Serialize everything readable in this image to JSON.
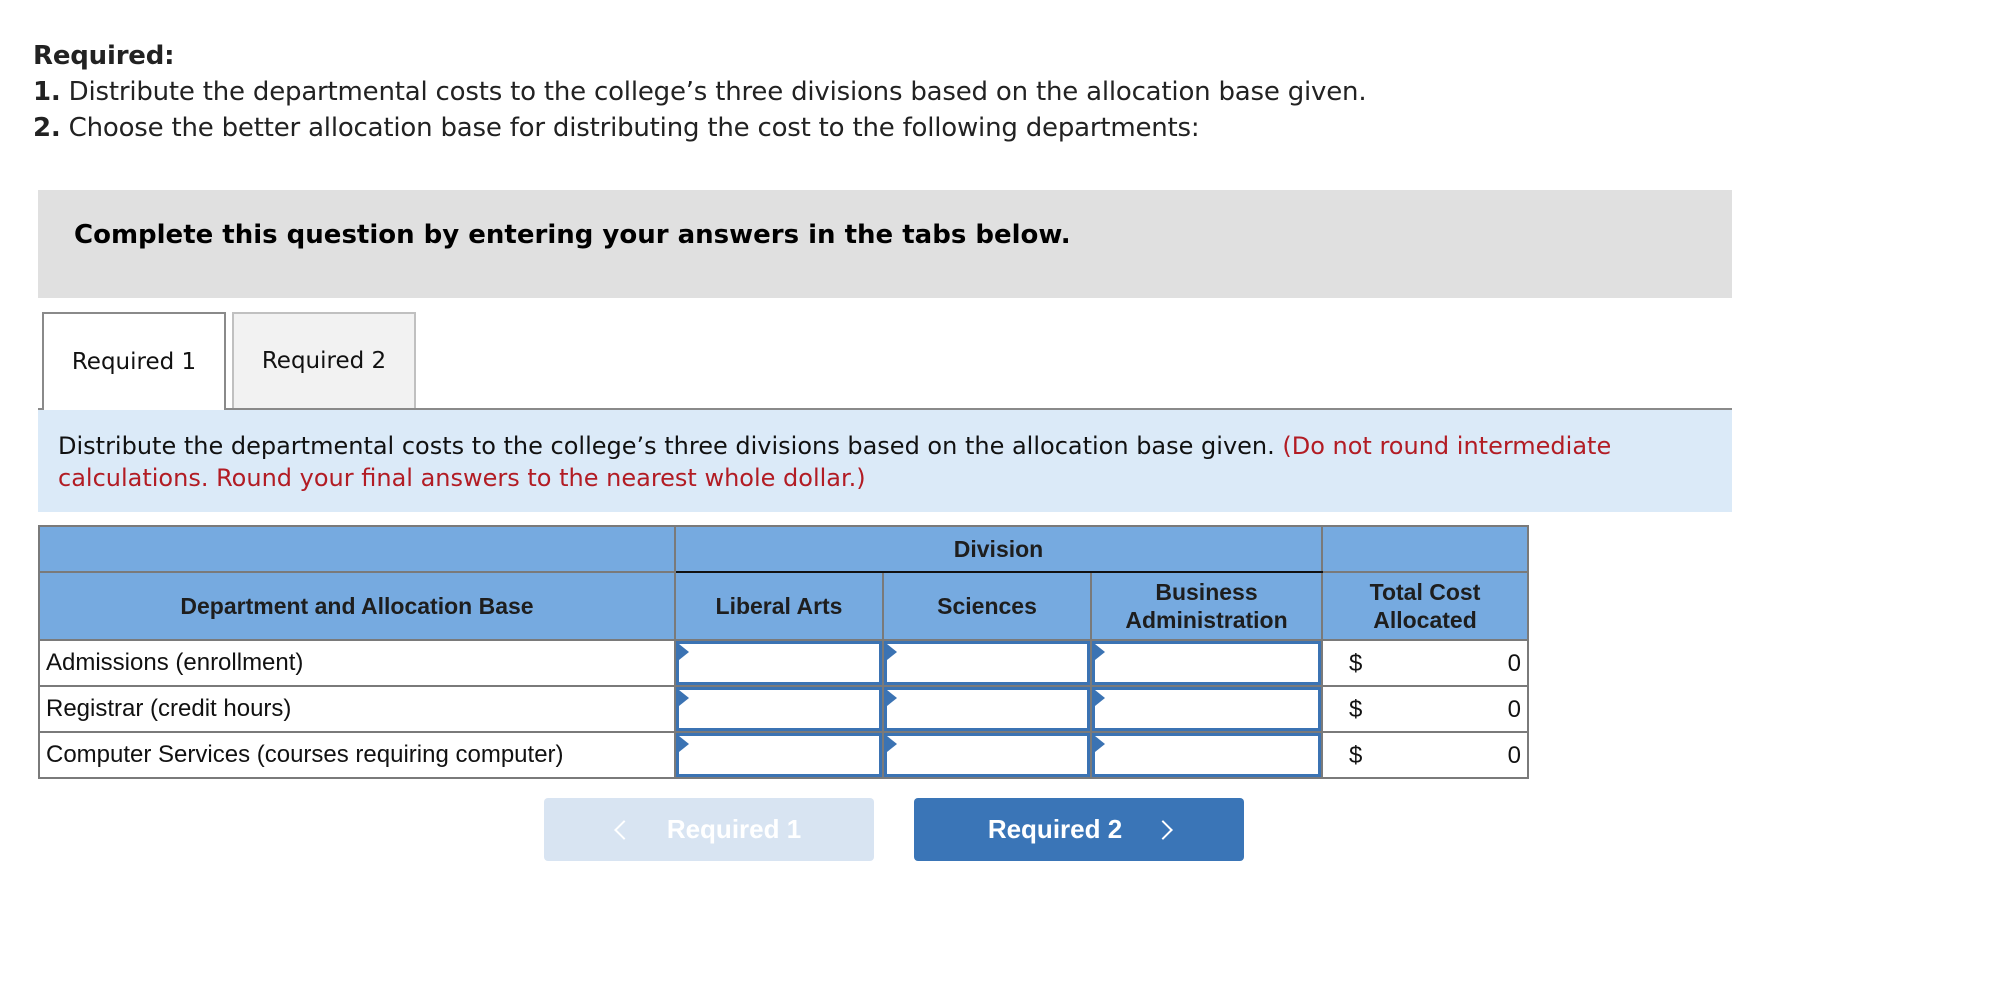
{
  "requirements": {
    "title": "Required:",
    "items": [
      {
        "number": "1.",
        "text": " Distribute the departmental costs to the college’s three divisions based on the allocation base given."
      },
      {
        "number": "2.",
        "text": " Choose the better allocation base for distributing the cost to the following departments:"
      }
    ]
  },
  "instruction": "Complete this question by entering your answers in the tabs below.",
  "tabs": [
    {
      "label": "Required 1",
      "active": true
    },
    {
      "label": "Required 2",
      "active": false
    }
  ],
  "info": {
    "text": "Distribute the departmental costs to the college’s three divisions based on the allocation base given. ",
    "note": "(Do not round intermediate calculations. Round your final answers to the nearest whole dollar.)"
  },
  "table": {
    "group_header": "Division",
    "columns": {
      "department": "Department and Allocation Base",
      "liberal_arts": "Liberal Arts",
      "sciences": "Sciences",
      "business_admin_line1": "Business",
      "business_admin_line2": "Administration",
      "total_line1": "Total Cost",
      "total_line2": "Allocated"
    },
    "rows": [
      {
        "label": "Admissions (enrollment)",
        "liberal_arts": "",
        "sciences": "",
        "business_admin": "",
        "currency": "$",
        "total": "0"
      },
      {
        "label": "Registrar (credit hours)",
        "liberal_arts": "",
        "sciences": "",
        "business_admin": "",
        "currency": "$",
        "total": "0"
      },
      {
        "label": "Computer Services (courses requiring computer)",
        "liberal_arts": "",
        "sciences": "",
        "business_admin": "",
        "currency": "$",
        "total": "0"
      }
    ]
  },
  "navigation": {
    "prev_label": "Required 1",
    "prev_enabled": false,
    "next_label": "Required 2",
    "next_enabled": true
  },
  "colors": {
    "header_blue": "#76aae0",
    "info_blue": "#dbeaf8",
    "note_red": "#b21c24",
    "button_blue": "#3a75b7",
    "button_disabled": "#d8e4f2",
    "input_border": "#3b73b3"
  }
}
